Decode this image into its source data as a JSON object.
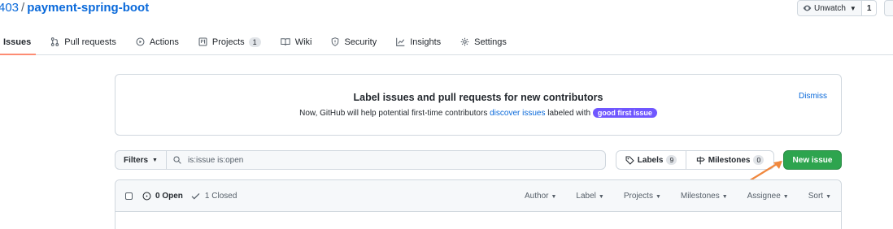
{
  "repo": {
    "owner_fragment": "403",
    "separator": "/",
    "name": "payment-spring-boot"
  },
  "watch": {
    "label": "Unwatch",
    "count": "1"
  },
  "tabs": [
    {
      "label": "Issues",
      "icon": "issue-opened-icon"
    },
    {
      "label": "Pull requests",
      "icon": "git-pull-request-icon"
    },
    {
      "label": "Actions",
      "icon": "play-icon"
    },
    {
      "label": "Projects",
      "icon": "project-icon",
      "counter": "1"
    },
    {
      "label": "Wiki",
      "icon": "book-icon"
    },
    {
      "label": "Security",
      "icon": "shield-icon"
    },
    {
      "label": "Insights",
      "icon": "graph-icon"
    },
    {
      "label": "Settings",
      "icon": "gear-icon"
    }
  ],
  "banner": {
    "title": "Label issues and pull requests for new contributors",
    "text_before": "Now, GitHub will help potential first-time contributors",
    "link": "discover issues",
    "text_after": "labeled with",
    "label_pill": "good first issue",
    "dismiss": "Dismiss"
  },
  "filters": {
    "button_label": "Filters",
    "search_value": "is:issue is:open",
    "labels_label": "Labels",
    "labels_count": "9",
    "milestones_label": "Milestones",
    "milestones_count": "0",
    "new_issue_label": "New issue"
  },
  "issues_header": {
    "open_label": "0 Open",
    "closed_label": "1 Closed",
    "menus": [
      "Author",
      "Label",
      "Projects",
      "Milestones",
      "Assignee",
      "Sort"
    ]
  },
  "colors": {
    "link": "#0969da",
    "primary_button": "#2da44e",
    "good_first_issue": "#7057ff",
    "annotation_arrow": "#f0883e",
    "selected_tab_underline": "#fd8c73"
  }
}
